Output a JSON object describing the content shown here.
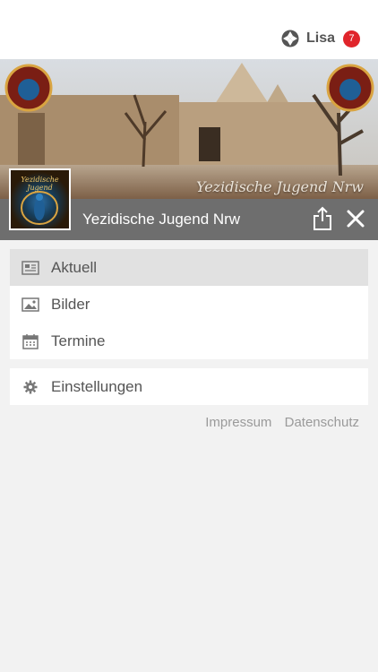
{
  "header": {
    "user_name": "Lisa",
    "notification_count": "7",
    "user_icon": "logo-icon"
  },
  "banner": {
    "caption": "Yezidische Jugend Nrw",
    "thumbnail_text": "Yezidische Jugend"
  },
  "page": {
    "title": "Yezidische Jugend Nrw",
    "share_icon": "share-icon",
    "close_icon": "close-icon"
  },
  "menu": {
    "items": [
      {
        "label": "Aktuell",
        "icon": "news-icon",
        "active": true
      },
      {
        "label": "Bilder",
        "icon": "image-icon",
        "active": false
      },
      {
        "label": "Termine",
        "icon": "calendar-icon",
        "active": false
      }
    ],
    "settings": {
      "label": "Einstellungen",
      "icon": "gear-icon"
    }
  },
  "footer": {
    "impressum": "Impressum",
    "datenschutz": "Datenschutz"
  },
  "colors": {
    "badge": "#e0252b",
    "title_bar": "#6e6e6e",
    "active_item": "#e1e1e1",
    "background": "#f2f2f2"
  }
}
